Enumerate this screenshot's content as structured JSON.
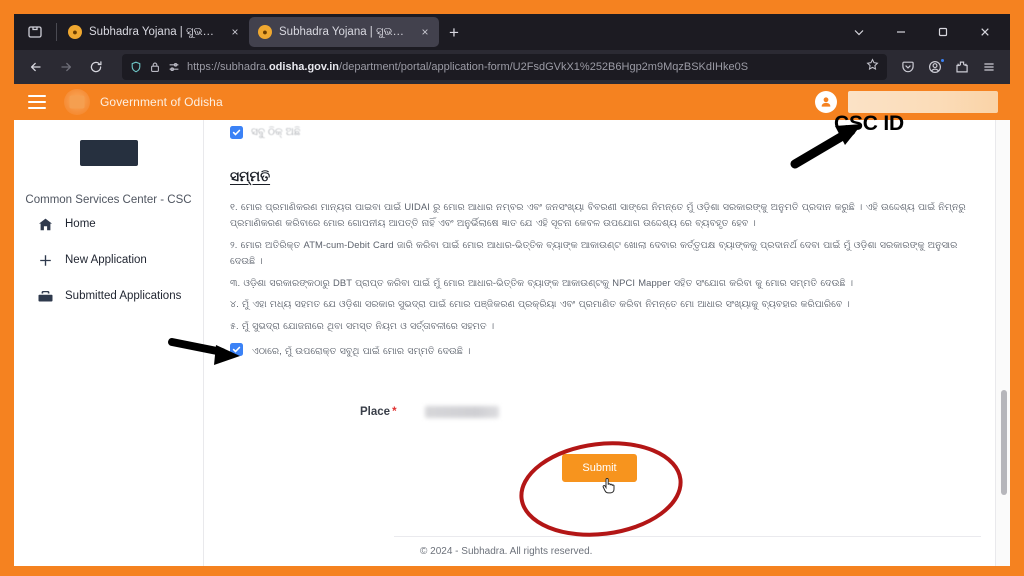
{
  "browser": {
    "firefox_view_tooltip": "Firefox View",
    "tabs": [
      {
        "title": "Subhadra Yojana | ସୁଭଦ୍ରା ଯୋଜନା",
        "active": false,
        "close_label": "×"
      },
      {
        "title": "Subhadra Yojana | ସୁଭଦ୍ରା ଯୋଜନା",
        "active": true,
        "close_label": "×"
      }
    ],
    "new_tab_label": "+",
    "window_controls": {
      "tab_list": "chevron-down",
      "minimize": "minimize",
      "maximize": "maximize",
      "close": "close"
    },
    "nav": {
      "back": "back-arrow",
      "forward": "forward-arrow",
      "reload": "reload"
    },
    "urlbar": {
      "shield_icon": "tracking-protection-shield",
      "lock_icon": "padlock",
      "permissions_icon": "page-permissions",
      "url_prefix": "https://subhadra.",
      "url_domain": "odisha.gov.in",
      "url_suffix": "/department/portal/application-form/U2FsdGVkX1%252B6Hgp2m9MqzBSKdIHke0S",
      "bookmark_icon": "star"
    },
    "toolbar_right": {
      "pocket": "pocket-icon",
      "account": "account-icon",
      "extensions": "extensions-icon",
      "app_menu": "app-menu-icon"
    }
  },
  "site_header": {
    "menu_icon": "hamburger-menu-icon",
    "emblem_icon": "odisha-government-emblem",
    "title": "Government of Odisha",
    "account_icon": "user-account-icon",
    "csc_id_redacted": true
  },
  "sidebar": {
    "logo_redacted": true,
    "title": "Common Services Center - CSC",
    "items": [
      {
        "label": "Home",
        "icon": "home-icon"
      },
      {
        "label": "New Application",
        "icon": "plus-icon"
      },
      {
        "label": "Submitted Applications",
        "icon": "briefcase-icon"
      }
    ]
  },
  "main": {
    "partial_top_item": "ସବୁ ଠିକ୍ ଅଛି",
    "consent_heading": "ସମ୍ମତି",
    "consent_items": [
      "୧. ମୋର ପ୍ରମାଣିକରଣ ମାନ୍ୟତା ପାଇବା ପାଇଁ UIDAI ରୁ ମୋର ଆଧାର ନମ୍ବର ଏବଂ ଜନସଂଖ୍ୟା ବିବରଣୀ ସାଙ୍ଗେ ନିମନ୍ତେ ମୁଁ ଓଡ଼ିଶା ସରକାରଙ୍କୁ ଅନୁମତି ପ୍ରଦାନ କରୁଛି । ଏହି ଉଦ୍ଦେଶ୍ୟ ପାଇଁ ନିମ୍ନରୁ ପ୍ରମାଣିକରଣ କରିବାରେ ମୋର ଗୋପନୀୟ ଆପତ୍ତି ନାହିଁ ଏବଂ ଅନୁର୍ଭିଲାଷେ ଜ୍ଞାତ ଯେ ଏହି ସୂଚନା କେବଳ ଉପଯୋଗ ଉଦ୍ଦେଶ୍ୟ ରେ ବ୍ୟବହୃତ ହେବ ।",
      "୨. ମୋର ଅତିରିକ୍ତ ATM-cum-Debit Card ଜାରି କରିବା ପାଇଁ ମୋର ଆଧାର-ଭିତ୍ତିକ ବ୍ୟାଙ୍କ ଆକାଉଣ୍ଟ ଖୋଲା ଦେବାର କର୍ତ୍ତୃପକ୍ଷ ବ୍ୟାଙ୍କକୁ ପ୍ରଦାନର୍ଥ ଦେବା ପାଇଁ ମୁଁ ଓଡ଼ିଶା ସରକାରଙ୍କୁ ଅନୁସାର ଦେଉଛି ।",
      "୩. ଓଡ଼ିଶା ସରକାରଙ୍କଠାରୁ DBT ପ୍ରାପ୍ତ କରିବା ପାଇଁ ମୁଁ ମୋର ଆଧାର-ଭିତ୍ତିକ ବ୍ୟାଙ୍କ ଆକାଉଣ୍ଟକୁ NPCI Mapper ସହିତ ସଂଯୋଗ କରିବା କୁ ମୋର ସମ୍ମତି ଦେଉଛି ।",
      "୪. ମୁଁ ଏହା ମଧ୍ୟ ସହମତ ଯେ ଓଡ଼ିଶା ସରକାର ସୁଭଦ୍ରା ପାଇଁ ମୋର ପଞ୍ଜିକରଣ ପ୍ରକ୍ରିୟା ଏବଂ ପ୍ରମାଣିତ କରିବା ନିମନ୍ତେ ମୋ ଆଧାର ସଂଖ୍ୟାକୁ ବ୍ୟବହାର କରିପାରିବେ ।",
      "୫. ମୁଁ ସୁଭଦ୍ରା ଯୋଜନାରେ ଥିବା ସମସ୍ତ ନିୟମ ଓ ସର୍ତ୍ତାବଳୀରେ ସହମତ ।"
    ],
    "final_consent": {
      "checked": true,
      "text": "ଏଠାରେ, ମୁଁ ଉପରୋକ୍ତ ସବୁଥି ପାଇଁ ମୋର ସମ୍ମତି ଦେଉଛି ।"
    },
    "place": {
      "label": "Place",
      "required_marker": "*",
      "value_redacted": true
    },
    "submit_label": "Submit",
    "footer": "© 2024 - Subhadra. All rights reserved."
  },
  "annotations": {
    "csc_id_label": "CSC ID",
    "csc_arrow": "black-arrow-pointing-up-right",
    "sidebar_arrow": "black-arrow-pointing-right",
    "submit_circle": "red-ellipse-highlight",
    "accent_colors": {
      "orange": "#f58220",
      "submit_orange": "#f7941e",
      "red_annotation": "#b31616",
      "checkbox_blue": "#3b82f6"
    }
  }
}
